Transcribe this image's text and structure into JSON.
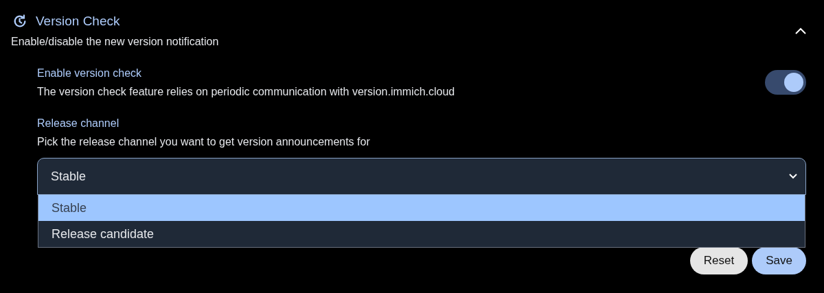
{
  "section": {
    "title": "Version Check",
    "description": "Enable/disable the new version notification",
    "expanded": true
  },
  "settings": [
    {
      "kind": "toggle",
      "label": "Enable version check",
      "description": "The version check feature relies on periodic communication with version.immich.cloud",
      "on": true
    },
    {
      "kind": "select",
      "label": "Release channel",
      "description": "Pick the release channel you want to get version announcements for",
      "value": "Stable",
      "expanded": true,
      "options": [
        {
          "label": "Stable",
          "selected": true
        },
        {
          "label": "Release candidate",
          "selected": false
        }
      ]
    }
  ],
  "buttons": [
    {
      "label": "Reset",
      "kind": "secondary"
    },
    {
      "label": "Save",
      "kind": "primary"
    }
  ]
}
